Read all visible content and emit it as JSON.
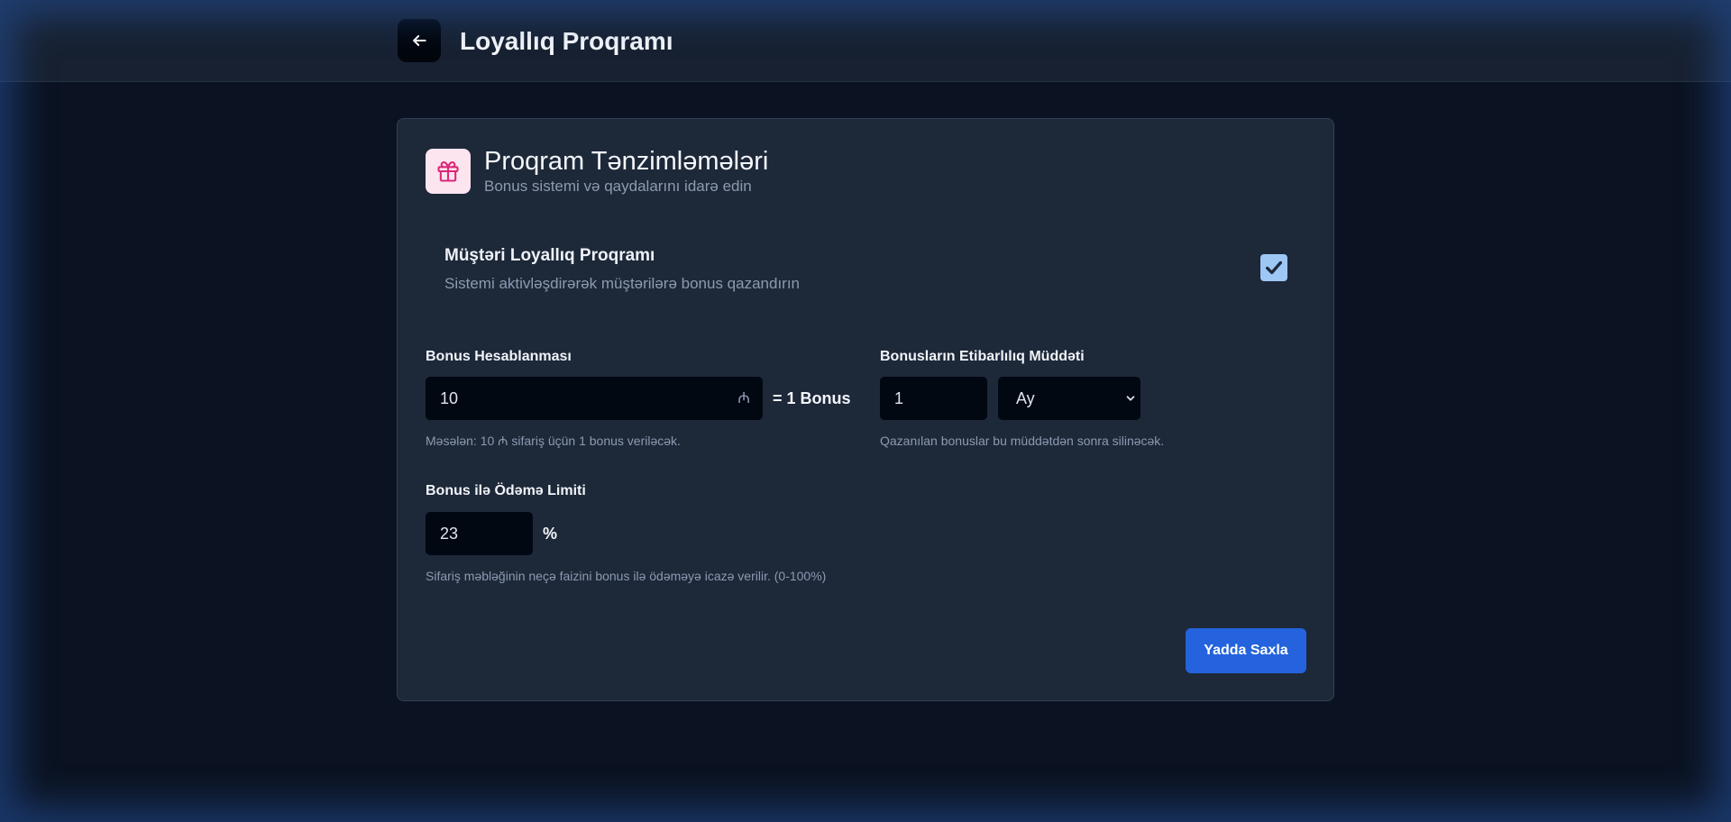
{
  "header": {
    "title": "Loyallıq Proqramı",
    "back_icon": "arrow-left-icon"
  },
  "card": {
    "icon": "gift-icon",
    "title": "Proqram Tənzimləmələri",
    "subtitle": "Bonus sistemi və qaydalarını idarə edin"
  },
  "loyalty_toggle": {
    "title": "Müştəri Loyallıq Proqramı",
    "description": "Sistemi aktivləşdirərək müştərilərə bonus qazandırın",
    "checked": true
  },
  "bonus_calc": {
    "label": "Bonus Hesablanması",
    "value": "10",
    "currency": "₼",
    "equals_text": "= 1 Bonus",
    "help": "Məsələn: 10 ₼ sifariş üçün 1 bonus veriləcək."
  },
  "validity": {
    "label": "Bonusların Etibarlılıq Müddəti",
    "value": "1",
    "unit_selected": "Ay",
    "help": "Qazanılan bonuslar bu müddətdən sonra silinəcək."
  },
  "payment_limit": {
    "label": "Bonus ilə Ödəmə Limiti",
    "value": "23",
    "unit": "%",
    "help": "Sifariş məbləğinin neçə faizini bonus ilə ödəməyə icazə verilir. (0-100%)"
  },
  "actions": {
    "save_label": "Yadda Saxla"
  },
  "colors": {
    "accent": "#2463dd",
    "background": "#0b1322",
    "card": "#1d2839",
    "input": "#020812",
    "checkbox": "#9ec7f5",
    "gift_icon": "#db2777"
  }
}
